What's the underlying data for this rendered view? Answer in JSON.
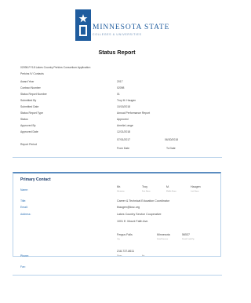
{
  "logo": {
    "title": "MINNESOTA STATE",
    "subtitle": "COLLEGES & UNIVERSITIES"
  },
  "report_title": "Status Report",
  "application_title": "02098-FY18 Lakes Country Perkins Consortium Application",
  "contacts_title": "Perkins IV Contacts",
  "fields": [
    {
      "label": "Award Year",
      "value": "2017"
    },
    {
      "label": "Contract Number",
      "value": "02098"
    },
    {
      "label": "Status Report Number",
      "value": "01"
    },
    {
      "label": "Submitted By",
      "value": "Troy M. Haugen"
    },
    {
      "label": "Submitted Date",
      "value": "10/15/2018"
    },
    {
      "label": "Status Report Type",
      "value": "Annual Performance Report"
    },
    {
      "label": "Status",
      "value": "Approved"
    },
    {
      "label": "Approved By",
      "value": "Amelia Lange"
    },
    {
      "label": "Approved Date",
      "value": "12/21/2018"
    }
  ],
  "report_period": {
    "label": "Report Period",
    "from_value": "07/01/2017",
    "to_value": "06/30/2018",
    "from_label": "From Date",
    "to_label": "To Date"
  },
  "primary_contact": {
    "title": "Primary Contact",
    "name_label": "Name:",
    "name_parts": [
      {
        "value": "Mr.",
        "caption": "Salutation"
      },
      {
        "value": "Troy",
        "caption": "First Name"
      },
      {
        "value": "M.",
        "caption": "Middle Name"
      },
      {
        "value": "Haugen",
        "caption": "Last Name"
      }
    ],
    "title_label": "Title:",
    "title_value": "Career & Technical Education Coordinator",
    "email_label": "Email:",
    "email_value": "thaugen@lcsc.org",
    "address_label": "Address:",
    "address_line1": "Lakes Country Service Cooperative",
    "address_line2": "1001 E. Mount Faith Ave.",
    "city": {
      "value": "Fergus Falls",
      "caption": "City"
    },
    "state": {
      "value": "Minnesota",
      "caption": "State/Province"
    },
    "zip": {
      "value": "56537",
      "caption": "Postal Code/Zip"
    },
    "phone_label": "Phone:",
    "phone_value": "218-737-8611",
    "phone_caption": "Phone",
    "phone_ext_caption": "Ext.",
    "fax_label": "Fax:"
  },
  "colors": {
    "brand_blue": "#1f5c9e",
    "label_blue": "#2a6fb4",
    "rule_blue": "#b8d2ea"
  }
}
